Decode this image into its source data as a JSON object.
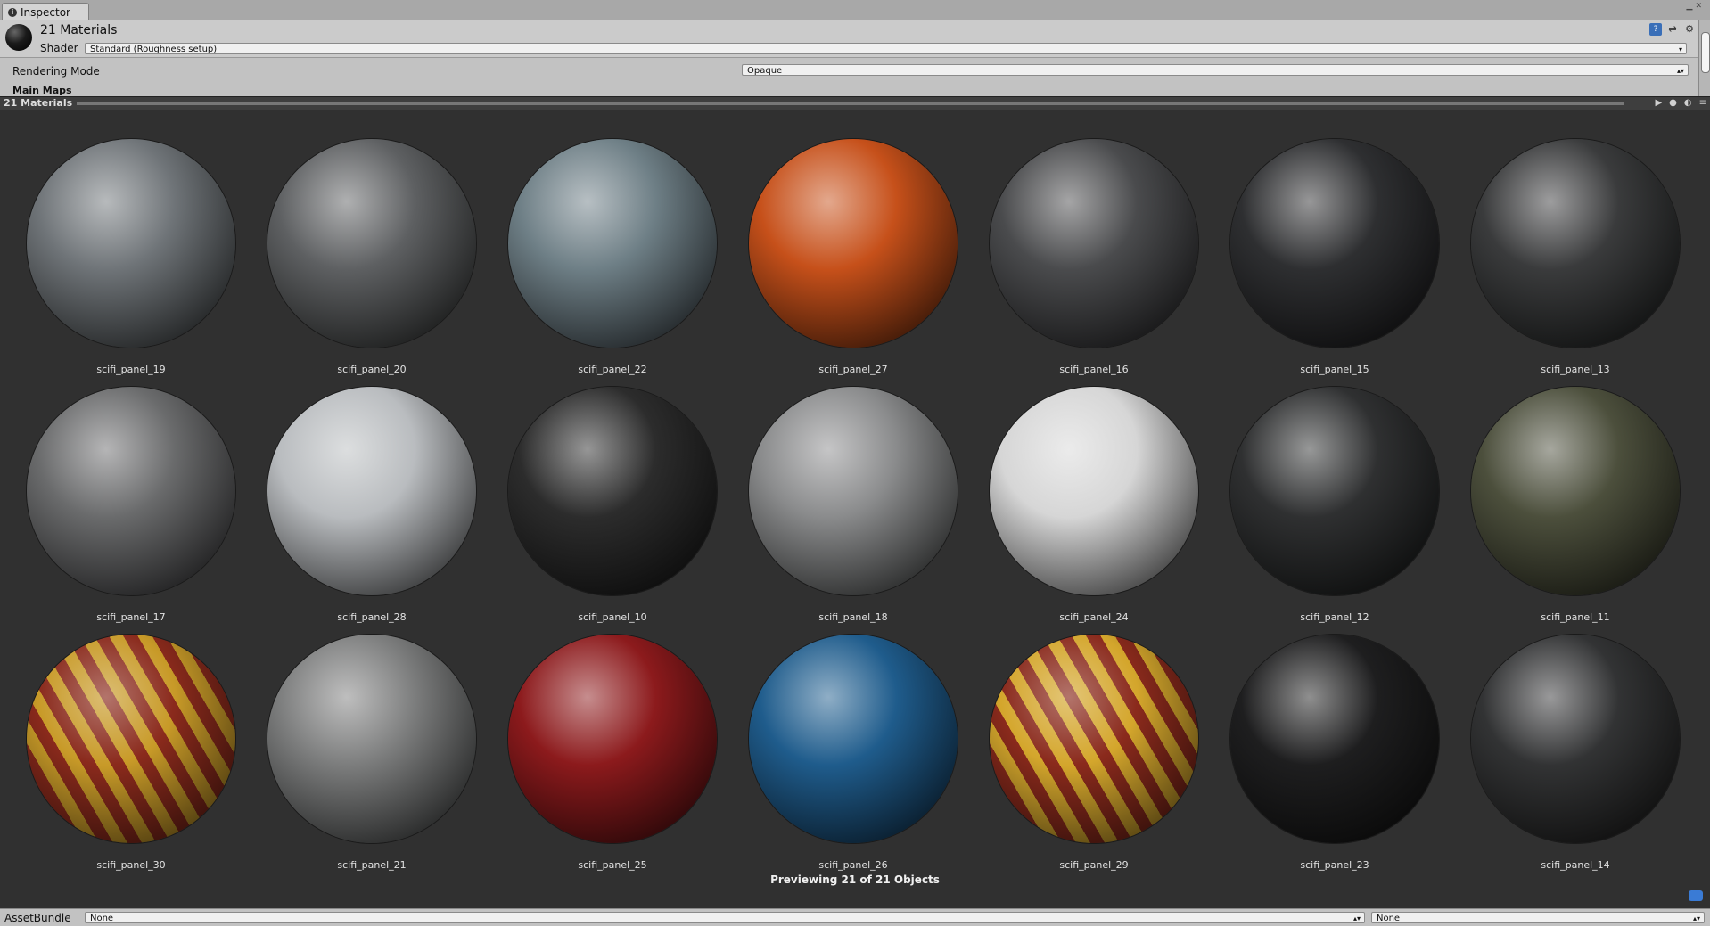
{
  "tab": {
    "label": "Inspector"
  },
  "header": {
    "title": "21 Materials",
    "shader_label": "Shader",
    "shader_value": "Standard (Roughness setup)"
  },
  "properties": {
    "rendering_mode_label": "Rendering Mode",
    "rendering_mode_value": "Opaque",
    "main_maps_label": "Main Maps"
  },
  "preview": {
    "title": "21 Materials",
    "status": "Previewing 21 of 21 Objects"
  },
  "materials": [
    {
      "name": "scifi_panel_19",
      "color": "#6f7478"
    },
    {
      "name": "scifi_panel_20",
      "color": "#5e6062"
    },
    {
      "name": "scifi_panel_22",
      "color": "#6e7f86"
    },
    {
      "name": "scifi_panel_27",
      "color": "#c6501a"
    },
    {
      "name": "scifi_panel_16",
      "color": "#4a4b4d"
    },
    {
      "name": "scifi_panel_15",
      "color": "#2e2f31"
    },
    {
      "name": "scifi_panel_13",
      "color": "#3a3b3c"
    },
    {
      "name": "scifi_panel_17",
      "color": "#6a6b6c"
    },
    {
      "name": "scifi_panel_28",
      "color": "#b9bcbf"
    },
    {
      "name": "scifi_panel_10",
      "color": "#2c2c2c"
    },
    {
      "name": "scifi_panel_18",
      "color": "#8a8b8c"
    },
    {
      "name": "scifi_panel_24",
      "color": "#d6d6d6"
    },
    {
      "name": "scifi_panel_12",
      "color": "#2f3031"
    },
    {
      "name": "scifi_panel_11",
      "color": "#4c4f3c"
    },
    {
      "name": "scifi_panel_30",
      "color": "#8a2a1c",
      "stripe": "#c89a28"
    },
    {
      "name": "scifi_panel_21",
      "color": "#7c7d7d"
    },
    {
      "name": "scifi_panel_25",
      "color": "#8c1a1c"
    },
    {
      "name": "scifi_panel_26",
      "color": "#1f5c8c"
    },
    {
      "name": "scifi_panel_29",
      "color": "#8a2a1c",
      "stripe": "#d4a62c"
    },
    {
      "name": "scifi_panel_23",
      "color": "#1e1e1f"
    },
    {
      "name": "scifi_panel_14",
      "color": "#323334"
    }
  ],
  "bottom": {
    "assetbundle_label": "AssetBundle",
    "assetbundle_value": "None",
    "variant_value": "None"
  }
}
